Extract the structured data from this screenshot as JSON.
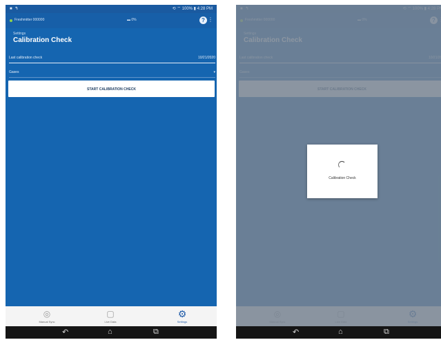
{
  "status_bar": {
    "left": "■ ↰",
    "right": "⟲ ⌔ 100% ▮ 4:28 PM"
  },
  "top_bar": {
    "device_name": "Freshmitter 000000",
    "battery": "▬ 0%",
    "help": "?",
    "more": "⋮"
  },
  "breadcrumb": "Settings",
  "page_title": "Calibration Check",
  "last_check": {
    "label": "Last calibration check",
    "value": "10/21/2020"
  },
  "gas_row": {
    "label": "Gases",
    "value": "▾"
  },
  "start_button": "START CALIBRATION CHECK",
  "bottom_nav": [
    {
      "label": "Manual Sync",
      "icon": "sync-icon",
      "glyph": "◎"
    },
    {
      "label": "Live Data",
      "icon": "live-data-icon",
      "glyph": "▢"
    },
    {
      "label": "Settings",
      "icon": "settings-icon",
      "glyph": "⚙"
    }
  ],
  "system_nav": {
    "back": "↶",
    "home": "⌂",
    "recent": "⧉"
  },
  "dialog": {
    "text": "Calibration Check"
  },
  "colors": {
    "app_blue": "#1565b0",
    "overlay": "#78848f",
    "white": "#ffffff"
  }
}
